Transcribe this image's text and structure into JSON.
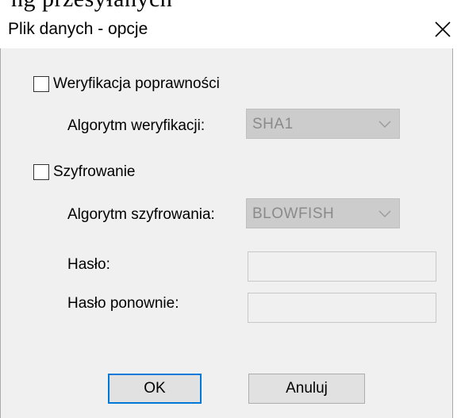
{
  "background_fragment": "ng przesyłanych",
  "dialog": {
    "title": "Plik danych - opcje",
    "close_glyph": "✕"
  },
  "verification": {
    "checkbox_label": "Weryfikacja poprawności",
    "checked": false,
    "algorithm_label": "Algorytm weryfikacji:",
    "algorithm_value": "SHA1"
  },
  "encryption": {
    "checkbox_label": "Szyfrowanie",
    "checked": false,
    "algorithm_label": "Algorytm szyfrowania:",
    "algorithm_value": "BLOWFISH",
    "password_label": "Hasło:",
    "password_value": "",
    "password_repeat_label": "Hasło ponownie:",
    "password_repeat_value": ""
  },
  "buttons": {
    "ok_label": "OK",
    "cancel_label": "Anuluj"
  },
  "colors": {
    "client_bg": "#f0f0f0",
    "disabled_combo_bg": "#cccccc",
    "disabled_text": "#8a8a8a",
    "focus_border": "#0078d7"
  },
  "icons": {
    "close": "close-icon",
    "combo_arrow": "chevron-down-icon"
  }
}
